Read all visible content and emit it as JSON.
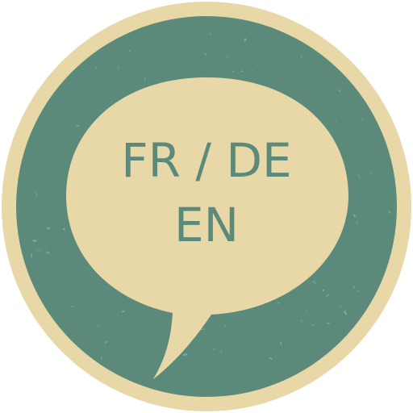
{
  "icon": {
    "name": "language-speech-bubble-icon",
    "colors": {
      "rim": "#e8d7a7",
      "disc": "#5b8a7a",
      "bubble": "#e8d7a7",
      "text": "#5b8a7a",
      "speckle": "#8fb3a6"
    },
    "text_lines": [
      "FR / DE",
      "EN"
    ]
  }
}
